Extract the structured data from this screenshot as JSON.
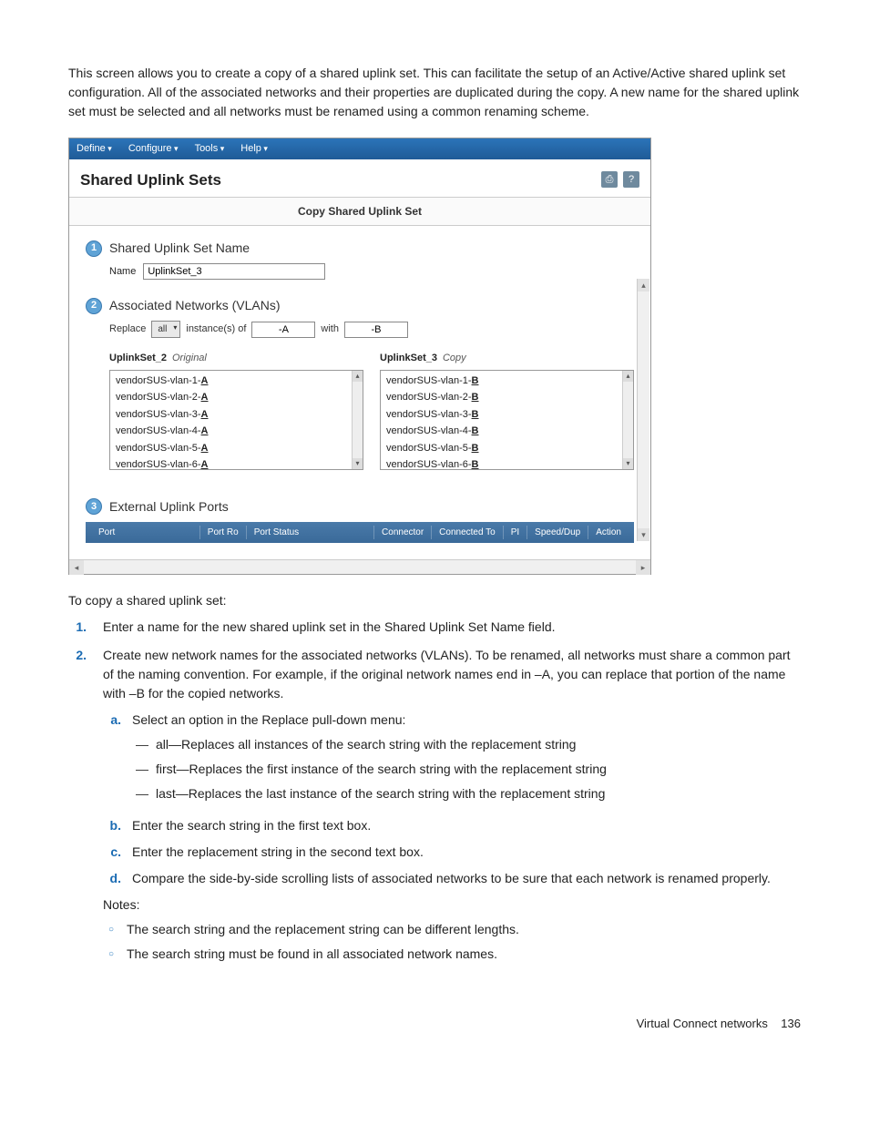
{
  "intro": "This screen allows you to create a copy of a shared uplink set. This can facilitate the setup of an Active/Active shared uplink set configuration. All of the associated networks and their properties are duplicated during the copy. A new name for the shared uplink set must be selected and all networks must be renamed using a common renaming scheme.",
  "screenshot": {
    "menubar": {
      "define": "Define",
      "configure": "Configure",
      "tools": "Tools",
      "help": "Help"
    },
    "title": "Shared Uplink Sets",
    "title_icons": {
      "print": "⎙",
      "help": "?"
    },
    "tab": "Copy Shared Uplink Set",
    "step1": {
      "num": "1",
      "heading": "Shared Uplink Set Name",
      "name_label": "Name",
      "name_value": "UplinkSet_3"
    },
    "step2": {
      "num": "2",
      "heading": "Associated Networks (VLANs)",
      "replace_label": "Replace",
      "replace_mode": "all",
      "instances_label": "instance(s) of",
      "search_value": "-A",
      "with_label": "with",
      "replace_value": "-B",
      "orig_header": "UplinkSet_2",
      "orig_sub": "Original",
      "copy_header": "UplinkSet_3",
      "copy_sub": "Copy",
      "orig_list": [
        {
          "base": "vendorSUS-vlan-1-",
          "suf": "A"
        },
        {
          "base": "vendorSUS-vlan-2-",
          "suf": "A"
        },
        {
          "base": "vendorSUS-vlan-3-",
          "suf": "A"
        },
        {
          "base": "vendorSUS-vlan-4-",
          "suf": "A"
        },
        {
          "base": "vendorSUS-vlan-5-",
          "suf": "A"
        },
        {
          "base": "vendorSUS-vlan-6-",
          "suf": "A"
        }
      ],
      "copy_list": [
        {
          "base": "vendorSUS-vlan-1-",
          "suf": "B"
        },
        {
          "base": "vendorSUS-vlan-2-",
          "suf": "B"
        },
        {
          "base": "vendorSUS-vlan-3-",
          "suf": "B"
        },
        {
          "base": "vendorSUS-vlan-4-",
          "suf": "B"
        },
        {
          "base": "vendorSUS-vlan-5-",
          "suf": "B"
        },
        {
          "base": "vendorSUS-vlan-6-",
          "suf": "B"
        }
      ]
    },
    "step3": {
      "num": "3",
      "heading": "External Uplink Ports",
      "columns": [
        "Port",
        "Port Ro",
        "Port Status",
        "Connector",
        "Connected To",
        "PI",
        "Speed/Dup",
        "Action"
      ]
    }
  },
  "instructions": {
    "lead": "To copy a shared uplink set:",
    "steps": {
      "s1": {
        "num": "1.",
        "text": "Enter a name for the new shared uplink set in the Shared Uplink Set Name field."
      },
      "s2": {
        "num": "2.",
        "text": "Create new network names for the associated networks (VLANs). To be renamed, all networks must share a common part of the naming convention. For example, if the original network names end in –A, you can replace that portion of the name with –B for the copied networks.",
        "a": {
          "m": "a.",
          "text": "Select an option in the Replace pull-down menu:"
        },
        "a_opts": {
          "all": "all—Replaces all instances of the search string with the replacement string",
          "first": "first—Replaces the first instance of the search string with the replacement string",
          "last": "last—Replaces the last instance of the search string with the replacement string"
        },
        "b": {
          "m": "b.",
          "text": "Enter the search string in the first text box."
        },
        "c": {
          "m": "c.",
          "text": "Enter the replacement string in the second text box."
        },
        "d": {
          "m": "d.",
          "text": "Compare the side-by-side scrolling lists of associated networks to be sure that each network is renamed properly."
        },
        "notes_label": "Notes:",
        "notes": {
          "n1": "The search string and the replacement string can be different lengths.",
          "n2": "The search string must be found in all associated network names."
        }
      }
    }
  },
  "footer": {
    "section": "Virtual Connect networks",
    "page": "136"
  }
}
